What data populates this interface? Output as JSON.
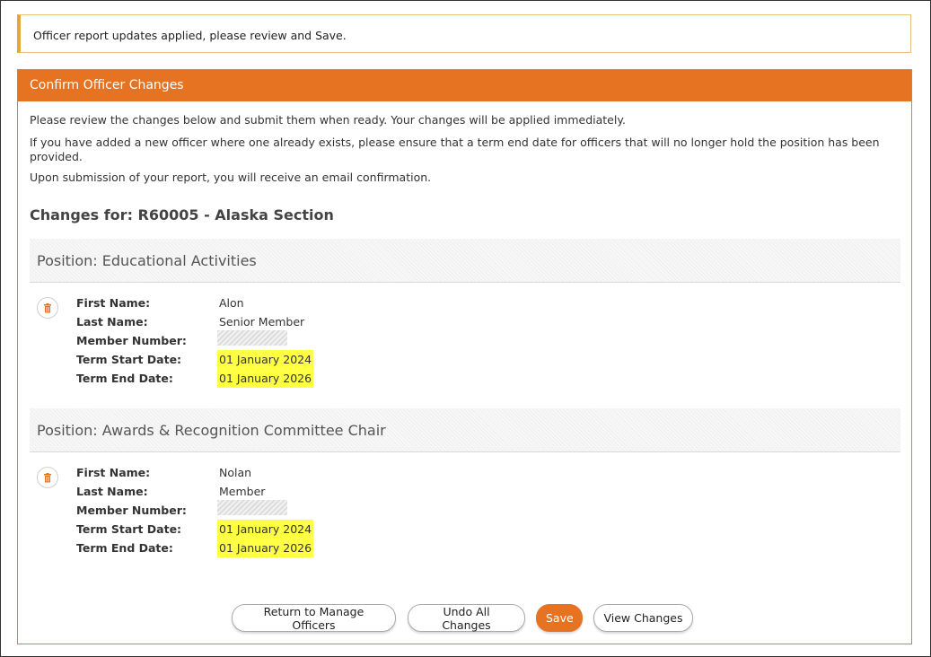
{
  "alert": {
    "message": "Officer report updates applied, please review and Save."
  },
  "panel": {
    "title": "Confirm Officer Changes",
    "intro": [
      "Please review the changes below and submit them when ready. Your changes will be applied immediately.",
      "If you have added a new officer where one already exists, please ensure that a term end date for officers that will no longer hold the position has been provided.",
      "Upon submission of your report, you will receive an email confirmation."
    ],
    "changes_title": "Changes for: R60005 - Alaska Section"
  },
  "labels": {
    "first_name": "First Name:",
    "last_name": "Last Name:",
    "member_number": "Member Number:",
    "term_start": "Term Start Date:",
    "term_end": "Term End Date:"
  },
  "positions": [
    {
      "title": "Position: Educational Activities",
      "first_name": "Alon",
      "last_name": "Senior Member",
      "term_start": "01 January 2024",
      "term_end": "01 January 2026"
    },
    {
      "title": "Position: Awards & Recognition Committee Chair",
      "first_name": "Nolan",
      "last_name": "Member",
      "term_start": "01 January 2024",
      "term_end": "01 January 2026"
    }
  ],
  "buttons": {
    "return": "Return to Manage Officers",
    "undo": "Undo All Changes",
    "save": "Save",
    "view": "View Changes"
  },
  "colors": {
    "accent": "#e67322",
    "highlight": "#ffff44",
    "alert_border": "#e0a93a"
  },
  "icons": {
    "delete": "trash-icon"
  }
}
